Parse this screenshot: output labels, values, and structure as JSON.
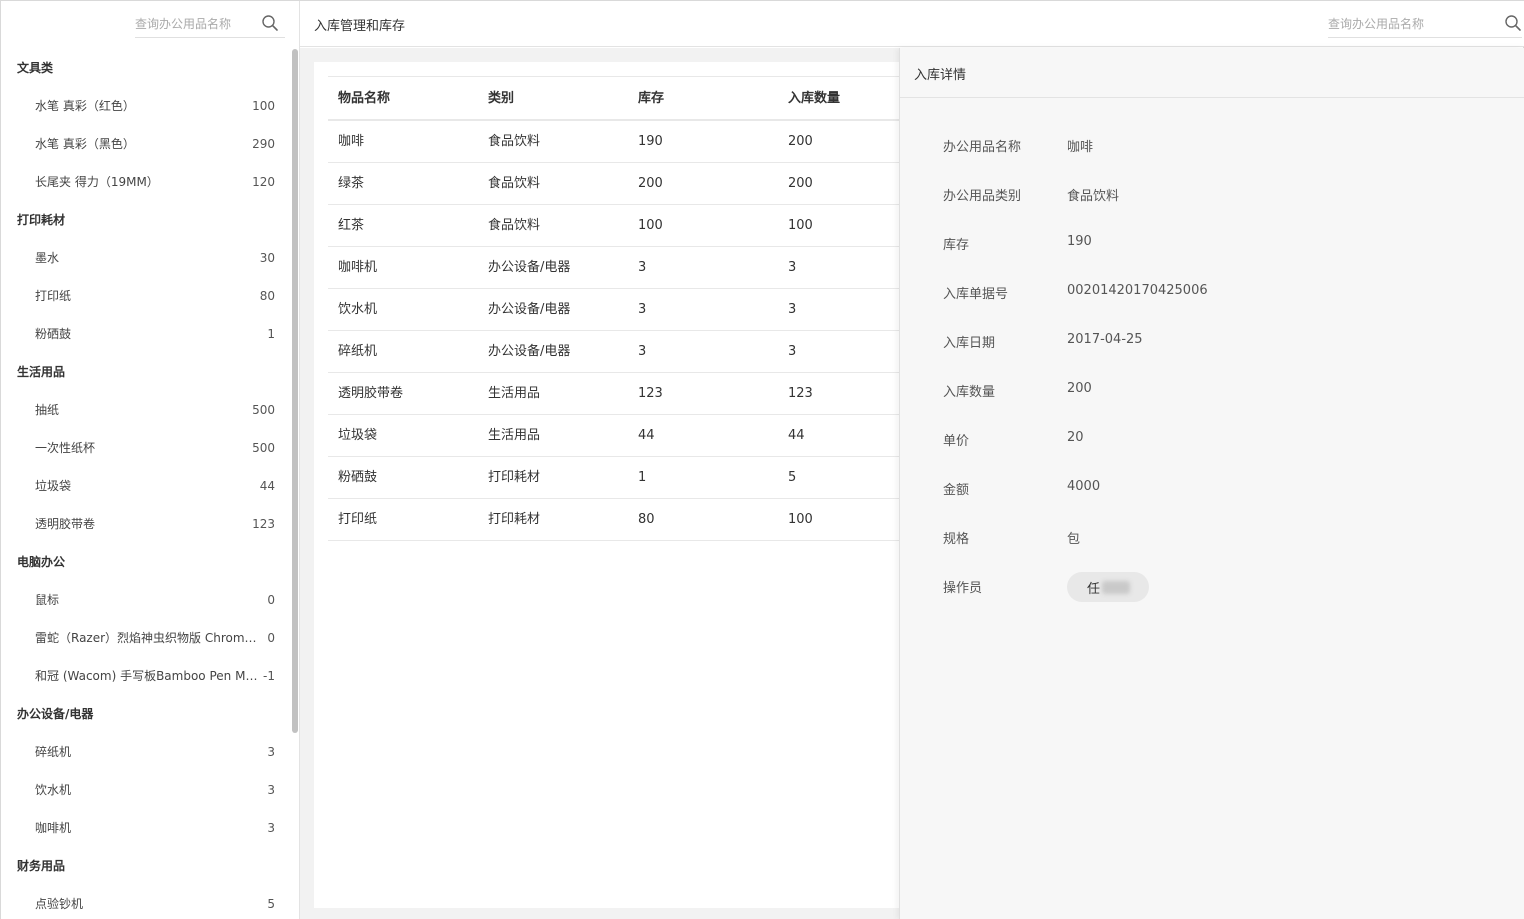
{
  "sidebar": {
    "search_placeholder": "查询办公用品名称",
    "categories": [
      {
        "name": "文具类",
        "items": [
          {
            "name": "水笔 真彩（红色）",
            "count": "100"
          },
          {
            "name": "水笔 真彩（黑色）",
            "count": "290"
          },
          {
            "name": "长尾夹 得力（19MM）",
            "count": "120"
          }
        ]
      },
      {
        "name": "打印耗材",
        "items": [
          {
            "name": "墨水",
            "count": "30"
          },
          {
            "name": "打印纸",
            "count": "80"
          },
          {
            "name": "粉硒鼓",
            "count": "1"
          }
        ]
      },
      {
        "name": "生活用品",
        "items": [
          {
            "name": "抽纸",
            "count": "500"
          },
          {
            "name": "一次性纸杯",
            "count": "500"
          },
          {
            "name": "垃圾袋",
            "count": "44"
          },
          {
            "name": "透明胶带卷",
            "count": "123"
          }
        ]
      },
      {
        "name": "电脑办公",
        "items": [
          {
            "name": "鼠标",
            "count": "0"
          },
          {
            "name": "雷蛇（Razer）烈焰神虫织物版 Chroma硬质...",
            "count": "0"
          },
          {
            "name": "和冠 (Wacom) 手写板Bamboo Pen Mediu...",
            "count": "-1"
          }
        ]
      },
      {
        "name": "办公设备/电器",
        "items": [
          {
            "name": "碎纸机",
            "count": "3"
          },
          {
            "name": "饮水机",
            "count": "3"
          },
          {
            "name": "咖啡机",
            "count": "3"
          }
        ]
      },
      {
        "name": "财务用品",
        "items": [
          {
            "name": "点验钞机",
            "count": "5"
          }
        ]
      }
    ]
  },
  "header": {
    "title": "入库管理和库存",
    "search_placeholder": "查询办公用品名称"
  },
  "table": {
    "columns": [
      "物品名称",
      "类别",
      "库存",
      "入库数量"
    ],
    "rows": [
      [
        "咖啡",
        "食品饮料",
        "190",
        "200"
      ],
      [
        "绿茶",
        "食品饮料",
        "200",
        "200"
      ],
      [
        "红茶",
        "食品饮料",
        "100",
        "100"
      ],
      [
        "咖啡机",
        "办公设备/电器",
        "3",
        "3"
      ],
      [
        "饮水机",
        "办公设备/电器",
        "3",
        "3"
      ],
      [
        "碎纸机",
        "办公设备/电器",
        "3",
        "3"
      ],
      [
        "透明胶带卷",
        "生活用品",
        "123",
        "123"
      ],
      [
        "垃圾袋",
        "生活用品",
        "44",
        "44"
      ],
      [
        "粉硒鼓",
        "打印耗材",
        "1",
        "5"
      ],
      [
        "打印纸",
        "打印耗材",
        "80",
        "100"
      ]
    ]
  },
  "detail": {
    "title": "入库详情",
    "fields": [
      {
        "label": "办公用品名称",
        "value": "咖啡"
      },
      {
        "label": "办公用品类别",
        "value": "食品饮料"
      },
      {
        "label": "库存",
        "value": "190"
      },
      {
        "label": "入库单据号",
        "value": "00201420170425006"
      },
      {
        "label": "入库日期",
        "value": "2017-04-25"
      },
      {
        "label": "入库数量",
        "value": "200"
      },
      {
        "label": "单价",
        "value": "20"
      },
      {
        "label": "金额",
        "value": "4000"
      },
      {
        "label": "规格",
        "value": "包"
      }
    ],
    "operator_label": "操作员",
    "operator_name": "任"
  },
  "icons": {
    "search": "search-icon"
  }
}
